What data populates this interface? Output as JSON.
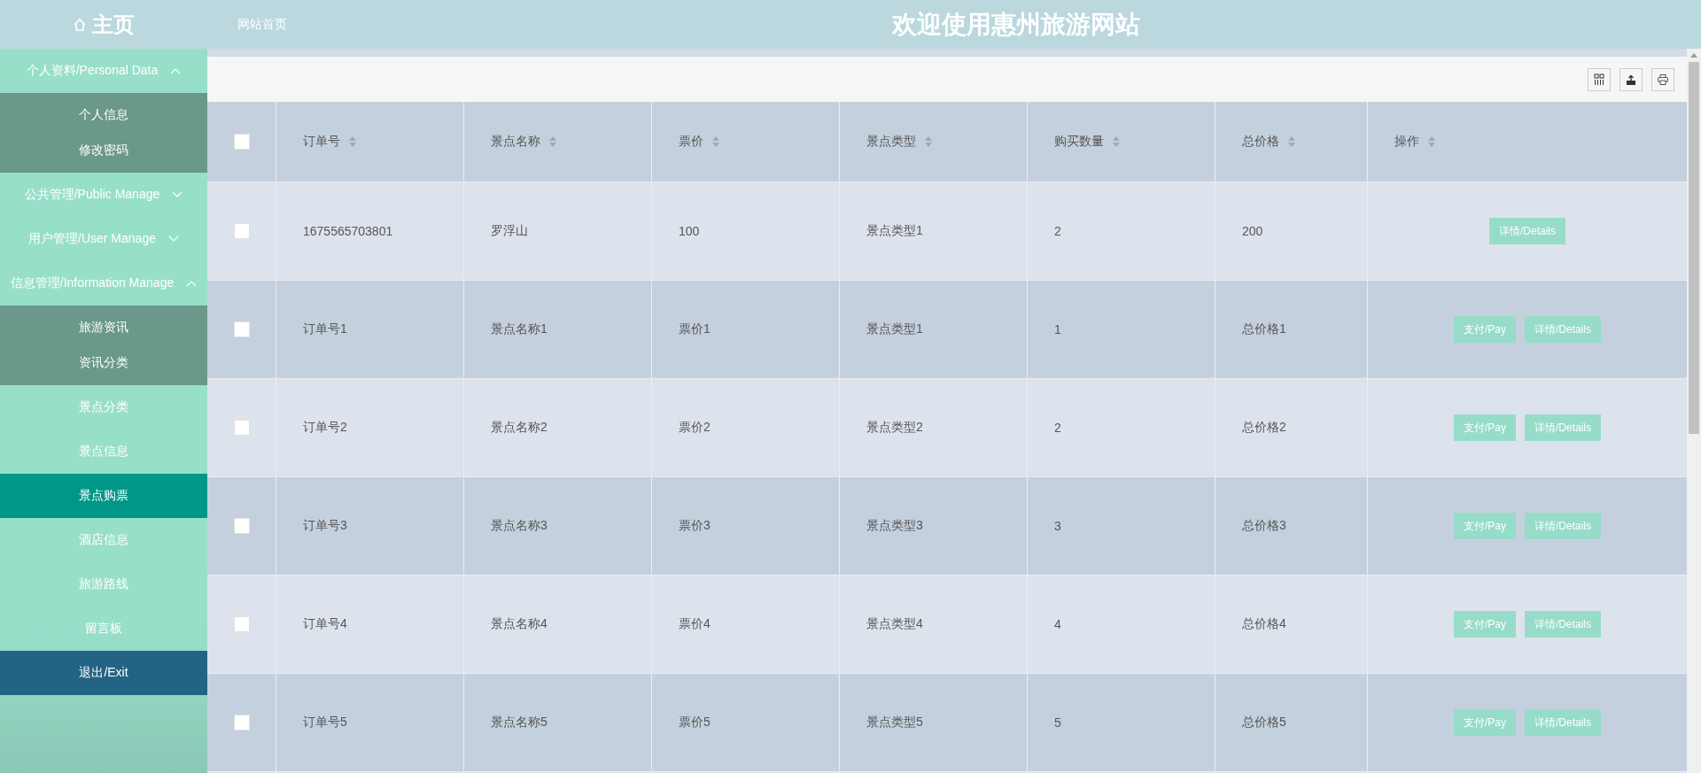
{
  "header": {
    "logo": "主页",
    "home_link": "网站首页",
    "title": "欢迎使用惠州旅游网站"
  },
  "sidebar": {
    "items": [
      {
        "kind": "group",
        "label": "个人资料/Personal Data",
        "expanded": true,
        "children": [
          {
            "label": "个人信息",
            "selected": false
          },
          {
            "label": "修改密码",
            "selected": false
          }
        ]
      },
      {
        "kind": "group",
        "label": "公共管理/Public Manage",
        "expanded": false
      },
      {
        "kind": "group",
        "label": "用户管理/User Manage",
        "expanded": false
      },
      {
        "kind": "group",
        "label": "信息管理/Information Manage",
        "expanded": true,
        "children": [
          {
            "label": "旅游资讯",
            "selected": false
          },
          {
            "label": "资讯分类",
            "selected": false
          }
        ]
      },
      {
        "kind": "item",
        "label": "景点分类",
        "selected": false
      },
      {
        "kind": "item",
        "label": "景点信息",
        "selected": false
      },
      {
        "kind": "item",
        "label": "景点购票",
        "selected": true
      },
      {
        "kind": "item",
        "label": "酒店信息",
        "selected": false
      },
      {
        "kind": "item",
        "label": "旅游路线",
        "selected": false
      },
      {
        "kind": "item",
        "label": "留言板",
        "selected": false
      },
      {
        "kind": "exit",
        "label": "退出/Exit",
        "selected": false
      }
    ]
  },
  "table": {
    "select_all": false,
    "columns": [
      "订单号",
      "景点名称",
      "票价",
      "景点类型",
      "购买数量",
      "总价格",
      "操作"
    ],
    "rows": [
      {
        "checked": false,
        "cells": [
          "1675565703801",
          "罗浮山",
          "100",
          "景点类型1",
          "2",
          "200"
        ],
        "buttons": [
          "详情/Details"
        ]
      },
      {
        "checked": false,
        "cells": [
          "订单号1",
          "景点名称1",
          "票价1",
          "景点类型1",
          "1",
          "总价格1"
        ],
        "buttons": [
          "支付/Pay",
          "详情/Details"
        ]
      },
      {
        "checked": false,
        "cells": [
          "订单号2",
          "景点名称2",
          "票价2",
          "景点类型2",
          "2",
          "总价格2"
        ],
        "buttons": [
          "支付/Pay",
          "详情/Details"
        ]
      },
      {
        "checked": false,
        "cells": [
          "订单号3",
          "景点名称3",
          "票价3",
          "景点类型3",
          "3",
          "总价格3"
        ],
        "buttons": [
          "支付/Pay",
          "详情/Details"
        ]
      },
      {
        "checked": false,
        "cells": [
          "订单号4",
          "景点名称4",
          "票价4",
          "景点类型4",
          "4",
          "总价格4"
        ],
        "buttons": [
          "支付/Pay",
          "详情/Details"
        ]
      },
      {
        "checked": false,
        "cells": [
          "订单号5",
          "景点名称5",
          "票价5",
          "景点类型5",
          "5",
          "总价格5"
        ],
        "buttons": [
          "支付/Pay",
          "详情/Details"
        ]
      }
    ]
  }
}
